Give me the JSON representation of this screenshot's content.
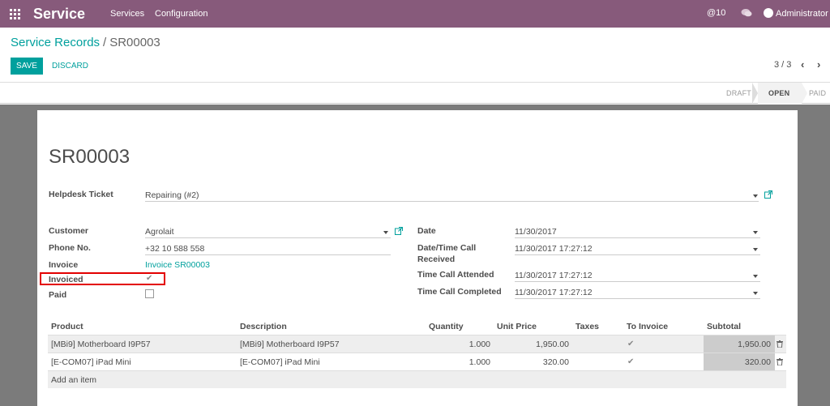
{
  "app": {
    "title": "Service",
    "menu": [
      "Services",
      "Configuration"
    ],
    "mentions": "@10",
    "user": "Administrator"
  },
  "breadcrumb": {
    "parent": "Service Records",
    "separator": "/",
    "current": "SR00003"
  },
  "actions": {
    "save": "SAVE",
    "discard": "DISCARD"
  },
  "pager": {
    "value": "3 / 3"
  },
  "stages": [
    "DRAFT",
    "OPEN",
    "PAID"
  ],
  "active_stage": "OPEN",
  "record": {
    "name": "SR00003",
    "helpdesk_label": "Helpdesk Ticket",
    "helpdesk_value": "Repairing (#2)",
    "customer_label": "Customer",
    "customer_value": "Agrolait",
    "phone_label": "Phone No.",
    "phone_value": "+32 10 588 558",
    "invoice_label": "Invoice",
    "invoice_value": "Invoice SR00003",
    "invoiced_label": "Invoiced",
    "invoiced_checked": true,
    "paid_label": "Paid",
    "paid_checked": false,
    "date_label": "Date",
    "date_value": "11/30/2017",
    "call_received_label_1": "Date/Time Call",
    "call_received_label_2": "Received",
    "call_received_value": "11/30/2017 17:27:12",
    "call_attended_label": "Time Call Attended",
    "call_attended_value": "11/30/2017 17:27:12",
    "call_completed_label": "Time Call Completed",
    "call_completed_value": "11/30/2017 17:27:12"
  },
  "table": {
    "headers": [
      "Product",
      "Description",
      "Quantity",
      "Unit Price",
      "Taxes",
      "To Invoice",
      "Subtotal"
    ],
    "rows": [
      {
        "product": "[MBi9] Motherboard I9P57",
        "description": "[MBi9] Motherboard I9P57",
        "quantity": "1.000",
        "unit_price": "1,950.00",
        "taxes": "",
        "to_invoice": true,
        "subtotal": "1,950.00"
      },
      {
        "product": "[E-COM07] iPad Mini",
        "description": "[E-COM07] iPad Mini",
        "quantity": "1.000",
        "unit_price": "320.00",
        "taxes": "",
        "to_invoice": true,
        "subtotal": "320.00"
      }
    ],
    "add_item": "Add an item"
  },
  "colors": {
    "brand": "#875a7b",
    "accent": "#00a09d",
    "highlight": "#e30000"
  }
}
